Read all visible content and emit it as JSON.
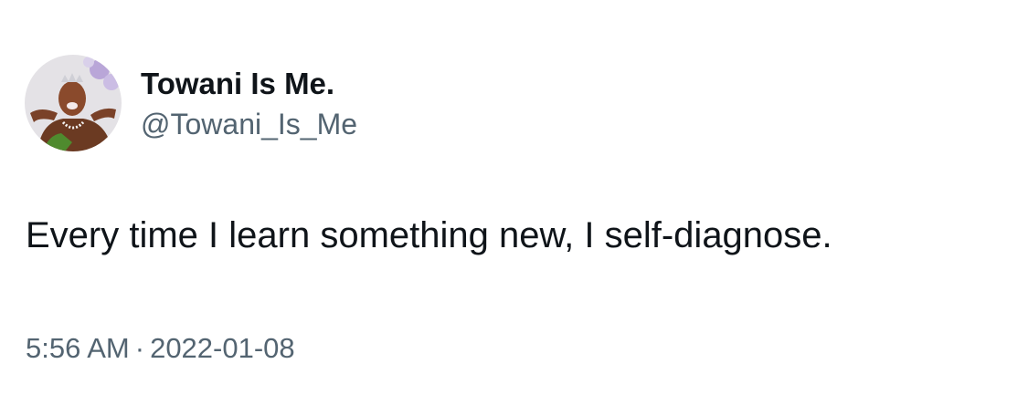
{
  "author": {
    "display_name": "Towani Is Me.",
    "handle": "@Towani_Is_Me"
  },
  "tweet": {
    "text": "Every time I learn something new, I self-diagnose."
  },
  "meta": {
    "time": "5:56 AM",
    "separator": "·",
    "date": "2022-01-08"
  },
  "colors": {
    "primary_text": "#0f1419",
    "secondary_text": "#536471",
    "background": "#ffffff"
  }
}
